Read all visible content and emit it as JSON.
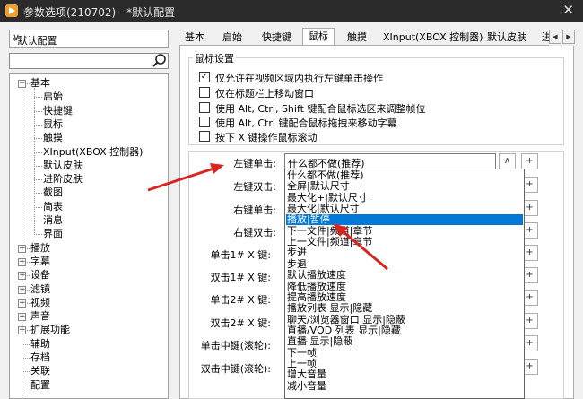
{
  "window": {
    "title": "参数选项(210702) - *默认配置",
    "close_glyph": "✕"
  },
  "profile_combo": {
    "value": "*默认配置",
    "arrow": "∨"
  },
  "search": {
    "placeholder": ""
  },
  "tree": {
    "items": [
      {
        "label": "基本",
        "level": 0,
        "expander": "−"
      },
      {
        "label": "启始",
        "level": 1
      },
      {
        "label": "快捷键",
        "level": 1
      },
      {
        "label": "鼠标",
        "level": 1
      },
      {
        "label": "触摸",
        "level": 1
      },
      {
        "label": "XInput(XBOX 控制器)",
        "level": 1
      },
      {
        "label": "默认皮肤",
        "level": 1
      },
      {
        "label": "进阶皮肤",
        "level": 1
      },
      {
        "label": "截图",
        "level": 1
      },
      {
        "label": "简表",
        "level": 1
      },
      {
        "label": "消息",
        "level": 1
      },
      {
        "label": "界面",
        "level": 1
      },
      {
        "label": "播放",
        "level": 0,
        "expander": "+"
      },
      {
        "label": "字幕",
        "level": 0,
        "expander": "+"
      },
      {
        "label": "设备",
        "level": 0,
        "expander": "+"
      },
      {
        "label": "滤镜",
        "level": 0,
        "expander": "+"
      },
      {
        "label": "视频",
        "level": 0,
        "expander": "+"
      },
      {
        "label": "声音",
        "level": 0,
        "expander": "+"
      },
      {
        "label": "扩展功能",
        "level": 0,
        "expander": "+"
      },
      {
        "label": "辅助",
        "level": 0
      },
      {
        "label": "存档",
        "level": 0
      },
      {
        "label": "关联",
        "level": 0
      },
      {
        "label": "配置",
        "level": 0
      }
    ]
  },
  "tabs": [
    {
      "label": "基本"
    },
    {
      "label": "启始"
    },
    {
      "label": "快捷键"
    },
    {
      "label": "鼠标",
      "active": true
    },
    {
      "label": "触摸"
    },
    {
      "label": "XInput(XBOX 控制器)"
    },
    {
      "label": "默认皮肤"
    },
    {
      "label": "进"
    }
  ],
  "tab_scroll": {
    "left": "◀",
    "right": "▶"
  },
  "mouse_settings": {
    "group_title": "鼠标设置",
    "options": [
      {
        "label": "仅允许在视频区域内执行左键单击操作",
        "checked": true
      },
      {
        "label": "仅在标题栏上移动窗口",
        "checked": false
      },
      {
        "label": "使用 Alt, Ctrl, Shift 键配合鼠标选区来调整帧位",
        "checked": false
      },
      {
        "label": "使用 Alt, Ctrl 键配合鼠标拖拽来移动字幕",
        "checked": false
      },
      {
        "label": "按下 X 键操作鼠标滚动",
        "checked": false
      }
    ],
    "check_glyph": "✓"
  },
  "actions": {
    "fields": [
      {
        "label": "左键单击:"
      },
      {
        "label": "左键双击:"
      },
      {
        "label": "右键单击:"
      },
      {
        "label": "右键双击:"
      },
      {
        "label": "单击1# X 键:"
      },
      {
        "label": "双击1# X 键:"
      },
      {
        "label": "单击2# X 键:"
      },
      {
        "label": "双击2# X 键:"
      },
      {
        "label": "单击中键(滚轮):"
      },
      {
        "label": "双击中键(滚轮):"
      }
    ],
    "selected_value": "什么都不做(推荐)",
    "up_glyph": "∧",
    "plus_glyph": "+",
    "options": [
      "什么都不做(推荐)",
      "全屏|默认尺寸",
      "最大化+|默认尺寸",
      "最大化|默认尺寸",
      "播放|暂停",
      "下一文件|频道|章节",
      "上一文件|频道|章节",
      "步进",
      "步退",
      "默认播放速度",
      "降低播放速度",
      "提高播放速度",
      "播放列表 显示|隐藏",
      "聊天/浏览器窗口 显示|隐蔽",
      "直播/VOD 列表 显示|隐藏",
      "直播 显示|隐蔽",
      "下一帧",
      "上一帧",
      "增大音量",
      "减小音量"
    ],
    "highlighted_index": 4
  },
  "colors": {
    "titlebar": "#2b2b2b",
    "selection": "#0078d7",
    "annotation_arrow": "#d9231f"
  }
}
